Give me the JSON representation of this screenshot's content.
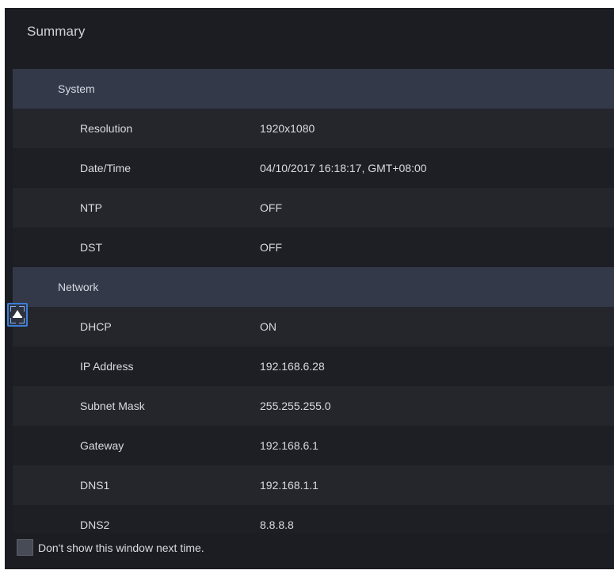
{
  "window": {
    "title": "Summary"
  },
  "system": {
    "label": "System",
    "rows": [
      {
        "label": "Resolution",
        "value": "1920x1080"
      },
      {
        "label": "Date/Time",
        "value": "04/10/2017 16:18:17, GMT+08:00"
      },
      {
        "label": "NTP",
        "value": "OFF"
      },
      {
        "label": "DST",
        "value": "OFF"
      }
    ]
  },
  "network": {
    "label": "Network",
    "rows": [
      {
        "label": "DHCP",
        "value": "ON"
      },
      {
        "label": "IP Address",
        "value": "192.168.6.28"
      },
      {
        "label": "Subnet Mask",
        "value": "255.255.255.0"
      },
      {
        "label": "Gateway",
        "value": "192.168.6.1"
      },
      {
        "label": "DNS1",
        "value": "192.168.1.1"
      },
      {
        "label": "DNS2",
        "value": "8.8.8.8"
      }
    ]
  },
  "footer": {
    "checkbox_label": "Don't show this window next time.",
    "checked": false
  },
  "colors": {
    "window_bg": "#1c1d22",
    "section_bg": "#34394a",
    "accent": "#3c7ed8"
  },
  "icons": {
    "scroll_handle": "scroll-to-top-icon"
  }
}
